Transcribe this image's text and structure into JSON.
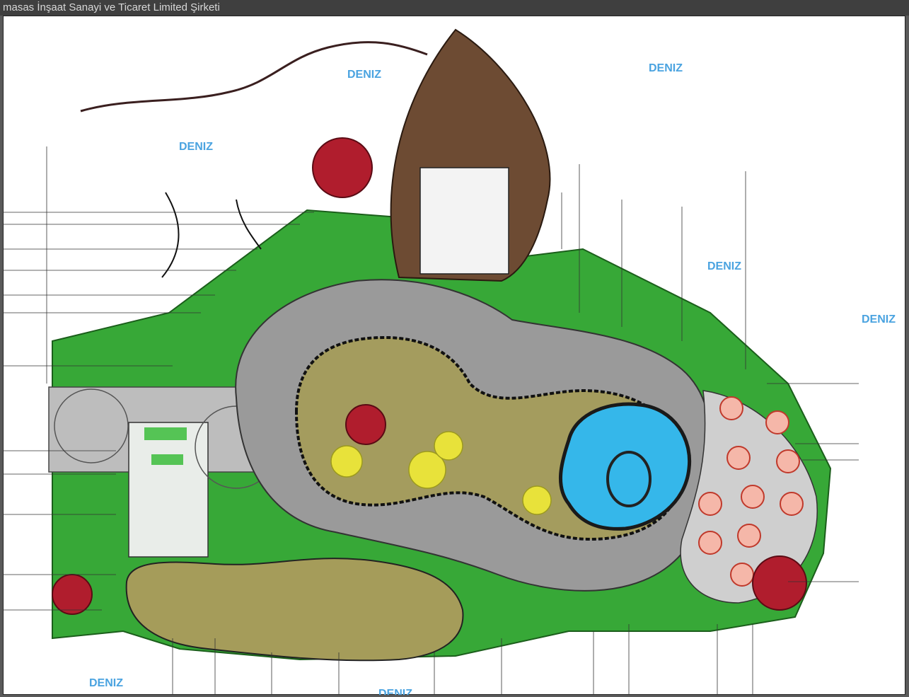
{
  "window": {
    "title": "masas İnşaat Sanayi ve Ticaret Limited Şirketi"
  },
  "sea_labels": [
    "DENIZ",
    "DENIZ",
    "DENIZ",
    "DENIZ",
    "DENIZ",
    "DENIZ",
    "DENIZ"
  ],
  "colors": {
    "lawn": "#2ea12e",
    "lawn_light": "#4cc04c",
    "pool": "#36b8ea",
    "deck": "#6b4a32",
    "path": "#8c8c8c",
    "gravel": "#a59c5a",
    "umbrella": "#b01d2d",
    "title_bg": "#3f3f3f"
  }
}
